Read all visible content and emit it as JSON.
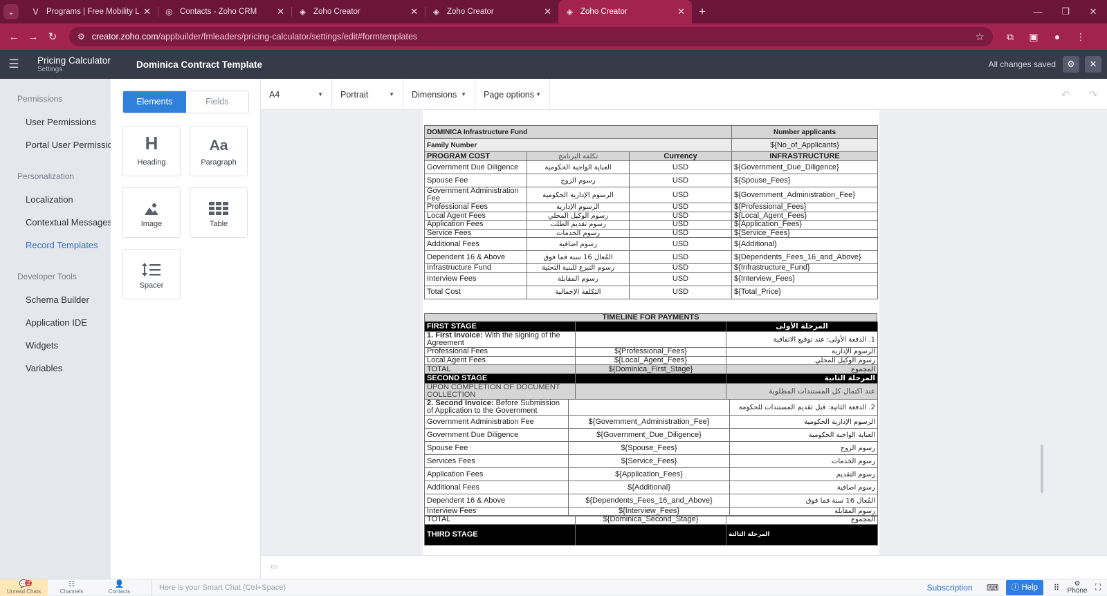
{
  "browser": {
    "tabs": [
      {
        "label": "Programs | Free Mobility Leade",
        "icon": "v-logo-icon",
        "active": false
      },
      {
        "label": "Contacts - Zoho CRM",
        "icon": "zoho-crm-icon",
        "active": false
      },
      {
        "label": "Zoho Creator",
        "icon": "zoho-creator-icon",
        "active": false
      },
      {
        "label": "Zoho Creator",
        "icon": "zoho-creator-icon",
        "active": false
      },
      {
        "label": "Zoho Creator",
        "icon": "zoho-creator-icon",
        "active": true
      }
    ],
    "url_host": "creator.zoho.com",
    "url_path": "/appbuilder/fmleaders/pricing-calculator/settings/edit#formtemplates"
  },
  "app": {
    "name": "Pricing Calculator",
    "subtitle": "Settings",
    "page_title": "Dominica Contract Template",
    "save_status": "All changes saved"
  },
  "sidebar": {
    "sections": [
      {
        "title": "Permissions",
        "items": [
          "User Permissions",
          "Portal User Permissions"
        ]
      },
      {
        "title": "Personalization",
        "items": [
          "Localization",
          "Contextual Messages",
          "Record Templates"
        ]
      },
      {
        "title": "Developer Tools",
        "items": [
          "Schema Builder",
          "Application IDE",
          "Widgets",
          "Variables"
        ]
      }
    ],
    "active_item": "Record Templates"
  },
  "elements_panel": {
    "tabs": [
      "Elements",
      "Fields"
    ],
    "cards": [
      {
        "label": "Heading",
        "glyph": "H"
      },
      {
        "label": "Paragraph",
        "glyph": "Aa"
      },
      {
        "label": "Image",
        "glyph": "image"
      },
      {
        "label": "Table",
        "glyph": "table"
      },
      {
        "label": "Spacer",
        "glyph": "spacer"
      }
    ]
  },
  "toolbar": {
    "paper_size": "A4",
    "orientation": "Portrait",
    "dimensions": "Dimensions",
    "page_options": "Page options"
  },
  "template": {
    "top_table": {
      "r1": [
        "DOMINICA Infrastructure Fund",
        "Number applicants"
      ],
      "r2": [
        "Family Number",
        "${No_of_Applicants}"
      ],
      "header": [
        "PROGRAM COST",
        "تكلفة البرنامج",
        "Currency",
        "INFRASTRUCTURE"
      ],
      "rows": [
        [
          "Government Due Diligence",
          "العناية الواجبة الحكومية",
          "USD",
          "${Government_Due_Diligence}"
        ],
        [
          "Spouse Fee",
          "رسوم الزوج",
          "USD",
          "${Spouse_Fees}"
        ],
        [
          "Government Administration Fee",
          "الرسوم الإدارية الحكومية",
          "USD",
          "${Government_Administration_Fee}"
        ],
        [
          "Professional Fees",
          "الرسوم الإدارية",
          "USD",
          "${Professional_Fees}"
        ],
        [
          "Local Agent Fees",
          "رسوم الوكيل المحلي",
          "USD",
          "${Local_Agent_Fees}"
        ],
        [
          "Application Fees",
          "رسوم تقديم الطلب",
          "USD",
          "${Application_Fees}"
        ],
        [
          "Service Fees",
          "رسوم الخدمات",
          "USD",
          "${Service_Fees}"
        ],
        [
          "Additional Fees",
          "رسوم اضافية",
          "USD",
          "${Additional}"
        ],
        [
          "Dependent 16 & Above",
          "المُعال 16 سنة فما فوق",
          "USD",
          "${Dependents_Fees_16_and_Above}"
        ],
        [
          "Infrastructure Fund",
          "رسوم التبرع للبنية التحتية",
          "USD",
          "${Infrastructure_Fund}"
        ],
        [
          "Interview Fees",
          "رسوم المقابلة",
          "USD",
          "${Interview_Fees}"
        ],
        [
          "Total Cost",
          "التكلفة الإجمالية",
          "USD",
          "${Total_Price}"
        ]
      ]
    },
    "timeline_title": "TIMELINE FOR PAYMENTS",
    "first_stage": {
      "title": "FIRST STAGE",
      "title_ar": "المرحلة الأولى",
      "invoice_bold": "1. First Invoice:",
      "invoice_text": " With the signing of the Agreement",
      "invoice_ar": "1. الدفعة الأولى: عند توقيع الاتفاقية",
      "rows": [
        [
          "Professional Fees",
          "${Professional_Fees}",
          "الرسوم الإدارية"
        ],
        [
          "Local Agent Fees",
          "${Local_Agent_Fees}",
          "رسوم الوكيل المحلي"
        ]
      ],
      "total": [
        "TOTAL",
        "${Dominica_First_Stage}",
        "المجموع"
      ]
    },
    "second_stage": {
      "title": "SECOND STAGE",
      "title_ar": "المرحلة الثانية",
      "completion": "UPON COMPLETION OF DOCUMENT COLLECTION",
      "completion_ar": "عند اكتمال كل المستندات المطلوبة",
      "invoice_bold": "2. Second Invoice:",
      "invoice_text": " Before Submission of Application to the Government",
      "invoice_ar": "2. الدفعة الثانية: قبل تقديم المستندات للحكومة",
      "rows": [
        [
          "Government Administration Fee",
          "${Government_Administration_Fee}",
          "الرسوم الإدارية الحكومية"
        ],
        [
          "Government Due Diligence",
          "${Government_Due_Diligence}",
          "العناية الواجبة الحكومية"
        ],
        [
          "Spouse Fee",
          "${Spouse_Fees}",
          "رسوم الزوج"
        ],
        [
          "Services Fees",
          "${Service_Fees}",
          "رسوم الخدمات"
        ],
        [
          "Application Fees",
          "${Application_Fees}",
          "رسوم التقديم"
        ],
        [
          "Additional Fees",
          "${Additional}",
          "رسوم اضافية"
        ],
        [
          "Dependent 16 & Above",
          "${Dependents_Fees_16_and_Above}",
          "المُعال 16 سنة فما فوق"
        ],
        [
          "Interview Fees",
          "${Interview_Fees}",
          "رسوم المقابلة"
        ]
      ],
      "total": [
        "TOTAL",
        "${Dominica_Second_Stage}",
        "المجموع"
      ]
    },
    "third_stage": {
      "title": "THIRD STAGE",
      "title_ar": "المرحلة الثالثة"
    }
  },
  "bottombar": {
    "unread_chats": "Unread Chats",
    "unread_count": "2",
    "channels": "Channels",
    "contacts": "Contacts",
    "smart_chat_placeholder": "Here is your Smart Chat (Ctrl+Space)",
    "subscription": "Subscription",
    "help": "Help",
    "phone": "Phone"
  }
}
